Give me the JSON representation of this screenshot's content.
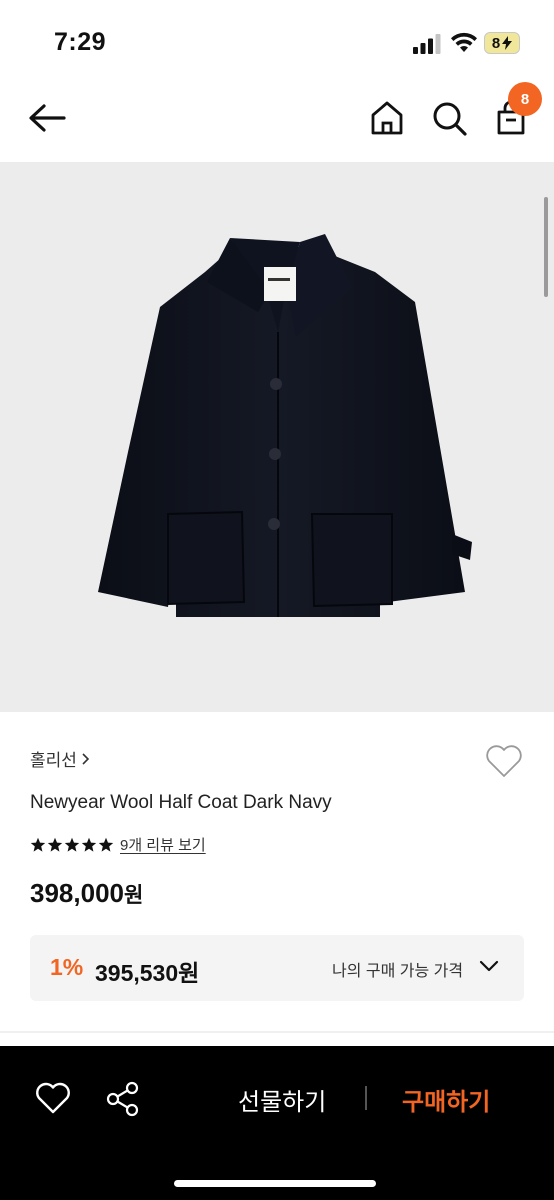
{
  "status_bar": {
    "time": "7:29",
    "battery": "8",
    "icons": [
      "signal-icon",
      "wifi-icon",
      "battery-charging-icon"
    ]
  },
  "nav": {
    "icons": [
      "back-arrow-icon",
      "home-icon",
      "search-icon",
      "shopping-bag-icon"
    ],
    "cart_count": "8"
  },
  "product": {
    "image_alt_icon": "navy-wool-coat-image",
    "brand": "홀리선",
    "title": "Newyear Wool Half Coat Dark Navy",
    "rating_stars": 5,
    "review_link": "9개 리뷰 보기",
    "price": "398,000",
    "price_unit": "원"
  },
  "my_price": {
    "discount_rate": "1%",
    "price": "395,530원",
    "label": "나의 구매 가능 가격"
  },
  "bottom_bar": {
    "gift_label": "선물하기",
    "buy_label": "구매하기"
  },
  "colors": {
    "accent": "#f26522",
    "bottom_bar_bg": "#000000",
    "image_bg": "#ececec"
  }
}
